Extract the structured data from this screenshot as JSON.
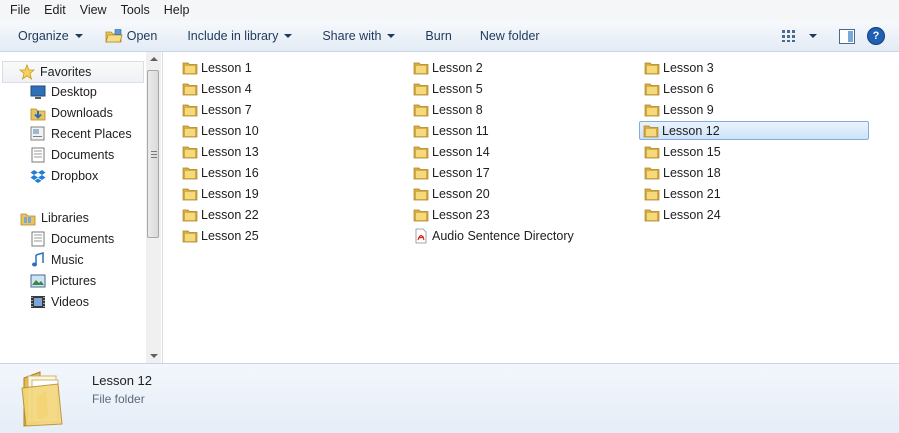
{
  "menu": [
    "File",
    "Edit",
    "View",
    "Tools",
    "Help"
  ],
  "toolbar": {
    "organize": "Organize",
    "open": "Open",
    "include": "Include in library",
    "share": "Share with",
    "burn": "Burn",
    "new_folder": "New folder"
  },
  "nav": {
    "favorites": "Favorites",
    "fav_items": [
      "Desktop",
      "Downloads",
      "Recent Places",
      "Documents",
      "Dropbox"
    ],
    "libraries": "Libraries",
    "lib_items": [
      "Documents",
      "Music",
      "Pictures",
      "Videos"
    ]
  },
  "files": [
    "Lesson 1",
    "Lesson 2",
    "Lesson 3",
    "Lesson 4",
    "Lesson 5",
    "Lesson 6",
    "Lesson 7",
    "Lesson 8",
    "Lesson 9",
    "Lesson 10",
    "Lesson 11",
    "Lesson 12",
    "Lesson 13",
    "Lesson 14",
    "Lesson 15",
    "Lesson 16",
    "Lesson 17",
    "Lesson 18",
    "Lesson 19",
    "Lesson 20",
    "Lesson 21",
    "Lesson 22",
    "Lesson 23",
    "Lesson 24",
    "Lesson 25",
    "Audio Sentence Directory"
  ],
  "selected_file": "Lesson 12",
  "details": {
    "name": "Lesson 12",
    "type": "File folder"
  },
  "icons": {
    "folder": "folder-icon",
    "pdf": "pdf-icon"
  }
}
